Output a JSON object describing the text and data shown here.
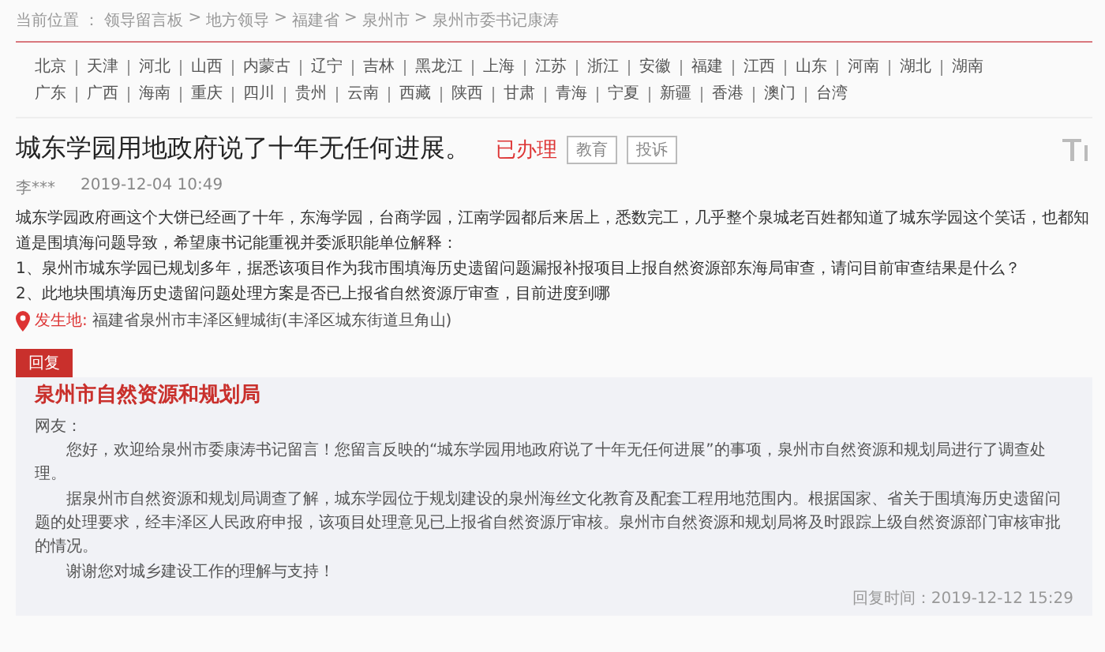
{
  "breadcrumb": {
    "label": "当前位置 ：",
    "separator": ">",
    "items": [
      "领导留言板",
      "地方领导",
      "福建省",
      "泉州市",
      "泉州市委书记康涛"
    ]
  },
  "regions": [
    [
      "北京",
      "天津",
      "河北",
      "山西",
      "内蒙古",
      "辽宁",
      "吉林",
      "黑龙江",
      "上海",
      "江苏",
      "浙江",
      "安徽",
      "福建",
      "江西",
      "山东",
      "河南",
      "湖北",
      "湖南"
    ],
    [
      "广东",
      "广西",
      "海南",
      "重庆",
      "四川",
      "贵州",
      "云南",
      "西藏",
      "陕西",
      "甘肃",
      "青海",
      "宁夏",
      "新疆",
      "香港",
      "澳门",
      "台湾"
    ]
  ],
  "message": {
    "title": "城东学园用地政府说了十年无任何进展。",
    "status": "已办理",
    "tags": [
      "教育",
      "投诉"
    ],
    "author": "李***",
    "date": "2019-12-04 10:49",
    "paragraphs": [
      "城东学园政府画这个大饼已经画了十年，东海学园，台商学园，江南学园都后来居上，悉数完工，几乎整个泉城老百姓都知道了城东学园这个笑话，也都知道是围填海问题导致，希望康书记能重视并委派职能单位解释：",
      "1、泉州市城东学园已规划多年，据悉该项目作为我市围填海历史遗留问题漏报补报项目上报自然资源部东海局审查，请问目前审查结果是什么？",
      "2、此地块围填海历史遗留问题处理方案是否已上报省自然资源厅审查，目前进度到哪"
    ],
    "location_label": "发生地:",
    "location": "福建省泉州市丰泽区鲤城街(丰泽区城东街道旦角山)"
  },
  "reply": {
    "tag": "回复",
    "org": "泉州市自然资源和规划局",
    "greeting": "网友：",
    "paragraphs": [
      "您好，欢迎给泉州市委康涛书记留言！您留言反映的“城东学园用地政府说了十年无任何进展”的事项，泉州市自然资源和规划局进行了调查处理。",
      "据泉州市自然资源和规划局调查了解，城东学园位于规划建设的泉州海丝文化教育及配套工程用地范围内。根据国家、省关于围填海历史遗留问题的处理要求，经丰泽区人民政府申报，该项目处理意见已上报省自然资源厅审核。泉州市自然资源和规划局将及时跟踪上级自然资源部门审核审批的情况。",
      "谢谢您对城乡建设工作的理解与支持！"
    ],
    "time": "回复时间：2019-12-12 15:29"
  }
}
